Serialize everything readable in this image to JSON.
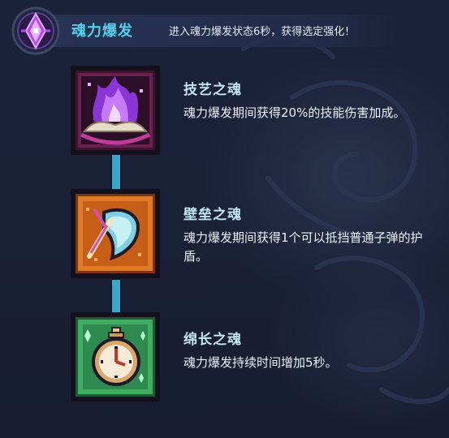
{
  "header": {
    "icon": "purple-crystal-icon",
    "title": "魂力爆发",
    "description": "进入魂力爆发状态6秒，获得选定强化！"
  },
  "skills": [
    {
      "icon": "purple-flame-icon",
      "name": "技艺之魂",
      "description": "魂力爆发期间获得20%的技能伤害加成。"
    },
    {
      "icon": "shield-icon",
      "name": "壁垒之魂",
      "description": "魂力爆发期间获得1个可以抵挡普通子弹的护盾。"
    },
    {
      "icon": "stopwatch-icon",
      "name": "绵长之魂",
      "description": "魂力爆发持续时间增加5秒。"
    }
  ],
  "colors": {
    "background": "#1a2036",
    "title_accent": "#55d0e8",
    "connector": "#3aa7c8",
    "skill1_frame": "#5a1f44",
    "skill2_frame": "#c9631d",
    "skill3_frame": "#2e8a4e"
  }
}
